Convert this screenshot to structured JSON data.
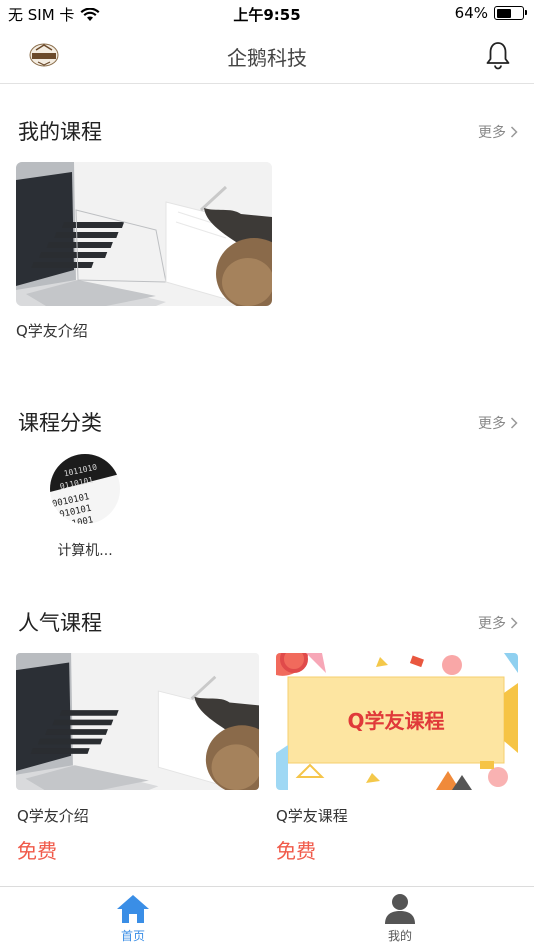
{
  "status": {
    "carrier": "无 SIM 卡",
    "time": "上午9:55",
    "battery": "64%",
    "battery_level": 0.64
  },
  "header": {
    "title": "企鹅科技"
  },
  "my_courses": {
    "title": "我的课程",
    "more": "更多",
    "items": [
      {
        "title": "Q学友介绍"
      }
    ]
  },
  "categories": {
    "title": "课程分类",
    "more": "更多",
    "items": [
      {
        "label": "计算机..."
      }
    ]
  },
  "popular": {
    "title": "人气课程",
    "more": "更多",
    "items": [
      {
        "title": "Q学友介绍",
        "price": "免费"
      },
      {
        "title": "Q学友课程",
        "price": "免费",
        "banner_text": "Q学友课程"
      }
    ]
  },
  "tabbar": {
    "home": "首页",
    "mine": "我的"
  },
  "colors": {
    "accent": "#3a8ee6",
    "price": "#f05a4a"
  }
}
